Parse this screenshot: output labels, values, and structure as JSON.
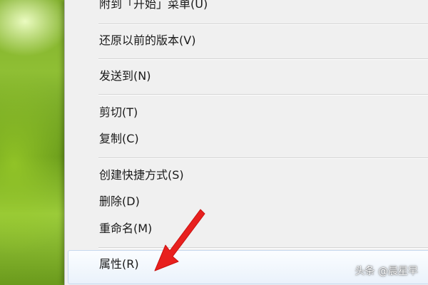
{
  "context_menu": {
    "items": [
      {
        "label": "附到「开始」菜单(U)"
      },
      {
        "label": "还原以前的版本(V)"
      },
      {
        "label": "发送到(N)"
      },
      {
        "label": "剪切(T)"
      },
      {
        "label": "复制(C)"
      },
      {
        "label": "创建快捷方式(S)"
      },
      {
        "label": "删除(D)"
      },
      {
        "label": "重命名(M)"
      },
      {
        "label": "属性(R)"
      }
    ],
    "highlighted_item": "属性(R)"
  },
  "watermark": {
    "text": "头条 @晨星早"
  },
  "colors": {
    "menu_background": "#f0f0f0",
    "arrow": "#e8201e",
    "highlight": "#eaf2fb"
  }
}
